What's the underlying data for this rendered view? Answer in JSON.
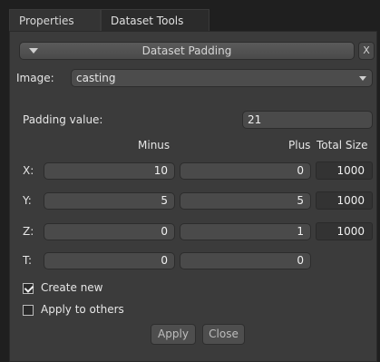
{
  "tabs": [
    {
      "label": "Properties"
    },
    {
      "label": "Dataset Tools"
    }
  ],
  "section": {
    "title": "Dataset Padding",
    "close_label": "X"
  },
  "image": {
    "label": "Image:",
    "value": "casting"
  },
  "padding": {
    "label": "Padding value:",
    "value": "21"
  },
  "columns": {
    "minus": "Minus",
    "plus": "Plus",
    "total": "Total Size"
  },
  "rows": [
    {
      "axis": "X:",
      "minus": "10",
      "plus": "0",
      "total": "1000"
    },
    {
      "axis": "Y:",
      "minus": "5",
      "plus": "5",
      "total": "1000"
    },
    {
      "axis": "Z:",
      "minus": "0",
      "plus": "1",
      "total": "1000"
    },
    {
      "axis": "T:",
      "minus": "0",
      "plus": "0"
    }
  ],
  "options": {
    "create_new": {
      "label": "Create new",
      "checked": true
    },
    "apply_to_others": {
      "label": "Apply to others",
      "checked": false
    }
  },
  "buttons": {
    "apply": "Apply",
    "close": "Close"
  }
}
